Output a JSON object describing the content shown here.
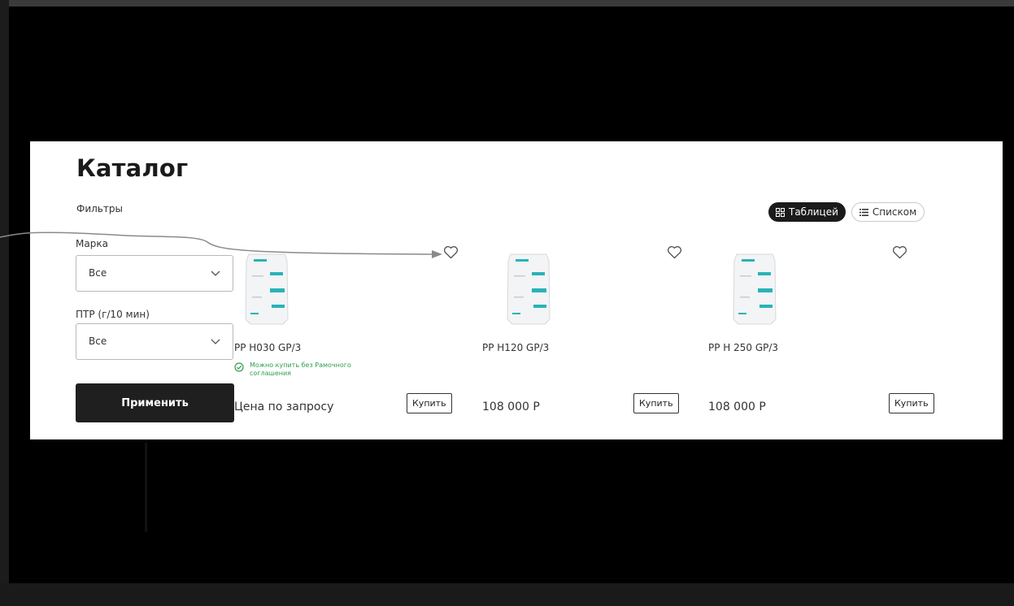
{
  "catalog": {
    "title": "Каталог",
    "filters_label": "Фильтры",
    "view_toggle": {
      "table": "Таблицей",
      "list": "Списком"
    },
    "filters": {
      "brand": {
        "label": "Марка",
        "value": "Все"
      },
      "mfi": {
        "label": "ПТР (г/10 мин)",
        "value": "Все"
      },
      "apply_button": "Применить"
    },
    "products": [
      {
        "name": "PP H030 GP/3",
        "availability": "Можно купить без Рамочного соглашения",
        "price": "Цена по запросу",
        "buy_button": "Купить"
      },
      {
        "name": "PP H120 GP/3",
        "price": "108 000 Р",
        "buy_button": "Купить"
      },
      {
        "name": "PP H 250 GP/3",
        "price": "108 000 Р",
        "buy_button": "Купить"
      }
    ]
  },
  "colors": {
    "availability_green": "#2e9e4f",
    "primary_dark": "#1f1f1f",
    "bag_accent": "#29b3b8",
    "annotation_arrow": "#8a8a8a"
  },
  "icons": {
    "favorite": "heart-icon",
    "grid": "grid-icon",
    "list": "list-icon",
    "dropdown": "chevron-down-icon",
    "availability": "check-circle-icon"
  }
}
